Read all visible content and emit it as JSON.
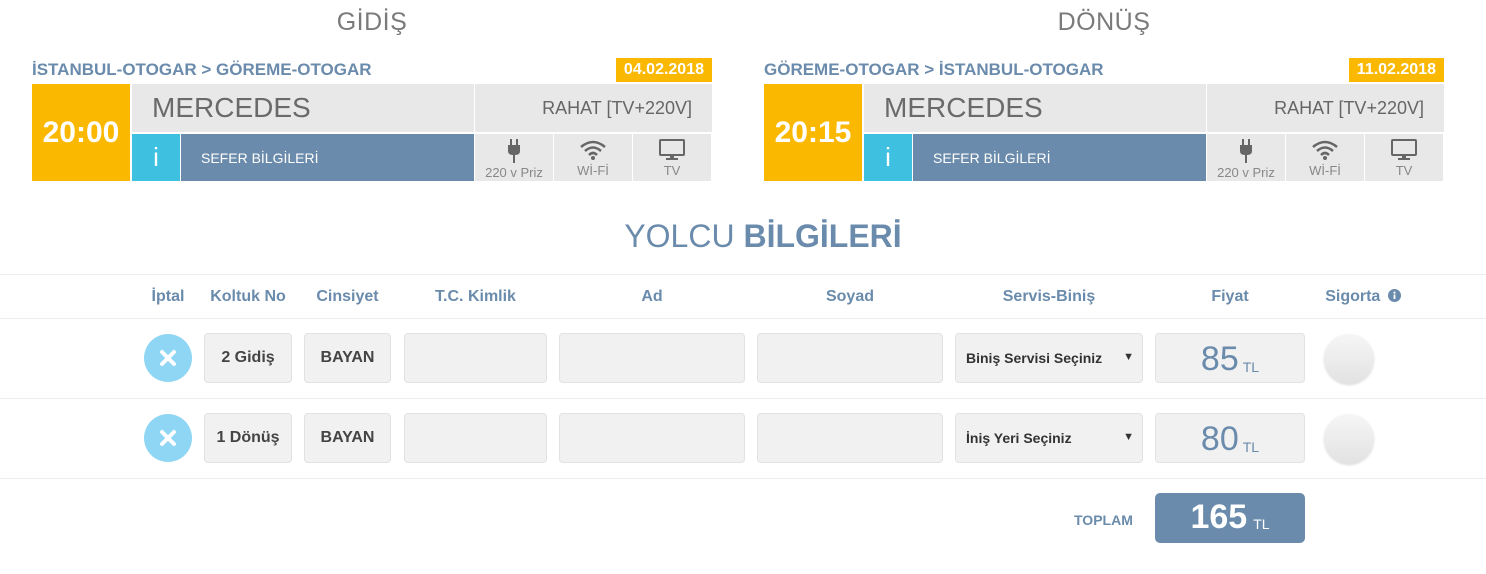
{
  "outbound": {
    "title": "GİDİŞ",
    "route": "İSTANBUL-OTOGAR > GÖREME-OTOGAR",
    "date": "04.02.2018",
    "time": "20:00",
    "company": "MERCEDES",
    "bus_class": "RAHAT [TV+220V]",
    "info_icon": "i",
    "details_label": "SEFER BİLGİLERİ",
    "features": [
      "220 v Priz",
      "Wİ-Fİ",
      "TV"
    ]
  },
  "return": {
    "title": "DÖNÜŞ",
    "route": "GÖREME-OTOGAR > İSTANBUL-OTOGAR",
    "date": "11.02.2018",
    "time": "20:15",
    "company": "MERCEDES",
    "bus_class": "RAHAT [TV+220V]",
    "info_icon": "i",
    "details_label": "SEFER BİLGİLERİ",
    "features": [
      "220 v Priz",
      "Wİ-Fİ",
      "TV"
    ]
  },
  "passengers": {
    "title_light": "YOLCU",
    "title_bold": "BİLGİLERİ",
    "columns": [
      "İptal",
      "Koltuk No",
      "Cinsiyet",
      "T.C. Kimlik",
      "Ad",
      "Soyad",
      "Servis-Biniş",
      "Fiyat",
      "Sigorta"
    ],
    "rows": [
      {
        "seat": "2 Gidiş",
        "gender": "BAYAN",
        "tc": "",
        "name": "",
        "surname": "",
        "service": "Biniş Servisi Seçiniz",
        "price": "85",
        "currency": "TL"
      },
      {
        "seat": "1 Dönüş",
        "gender": "BAYAN",
        "tc": "",
        "name": "",
        "surname": "",
        "service": "İniş Yeri Seçiniz",
        "price": "80",
        "currency": "TL"
      }
    ],
    "total_label": "TOPLAM",
    "total": "165",
    "total_currency": "TL"
  },
  "icons": {
    "plug": "plug-icon",
    "wifi": "wifi-icon",
    "tv": "tv-icon",
    "info": "info-circle-icon",
    "cancel": "close-icon"
  },
  "colors": {
    "accent": "#fbb800",
    "primary": "#6a8bab",
    "info": "#3ec1e0",
    "cancel": "#8fd6f5"
  }
}
